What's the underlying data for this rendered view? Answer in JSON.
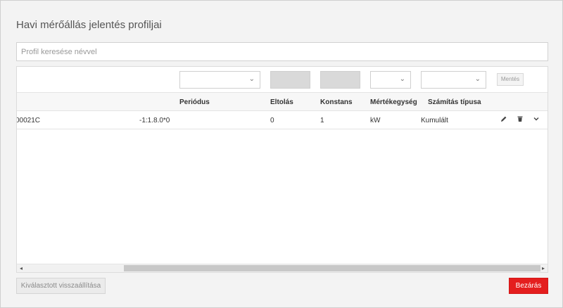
{
  "dialog": {
    "title": "Havi mérőállás jelentés profiljai"
  },
  "search": {
    "placeholder": "Profil keresése névvel",
    "value": ""
  },
  "filters": {
    "save_label": "Mentés"
  },
  "table": {
    "headers": {
      "period": "Periódus",
      "offset": "Eltolás",
      "constant": "Konstans",
      "unit": "Mértékegység",
      "calc_type": "Számítás típusa"
    },
    "rows": [
      {
        "name_prefix": "00021C",
        "name_suffix": "-1:1.8.0*0",
        "period": "",
        "offset": "0",
        "constant": "1",
        "unit": "kW",
        "calc_type": "Kumulált"
      }
    ]
  },
  "footer": {
    "reset_label": "Kiválasztott visszaállítása",
    "close_label": "Bezárás"
  },
  "colors": {
    "accent": "#e41e1e"
  },
  "icons": {
    "edit": "pencil-icon",
    "delete": "trash-icon",
    "expand": "chevron-down-icon",
    "scroll_left": "arrow-left-icon",
    "scroll_right": "arrow-right-icon"
  }
}
